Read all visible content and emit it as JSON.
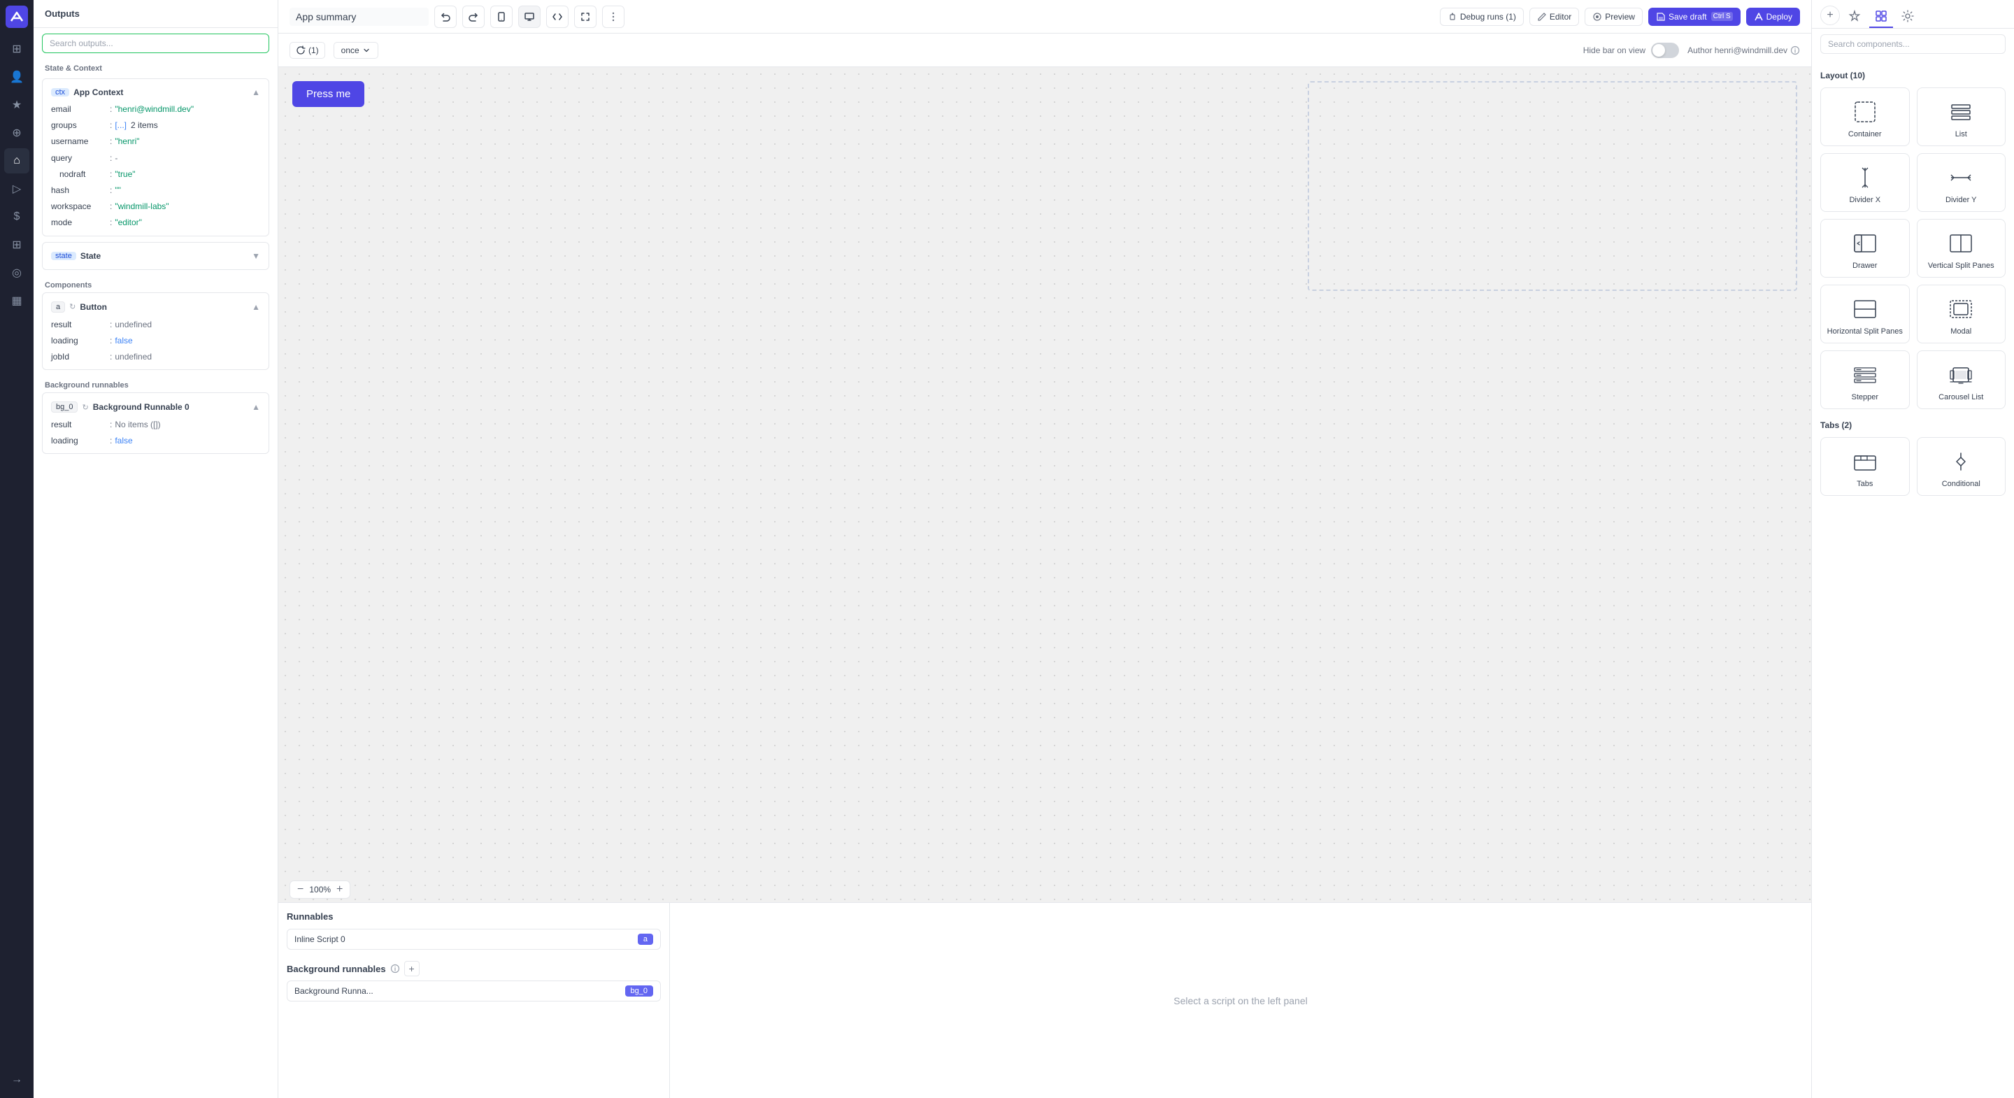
{
  "topbar": {
    "app_title": "App summary",
    "debug_label": "Debug runs (1)",
    "editor_label": "Editor",
    "preview_label": "Preview",
    "save_draft_label": "Save draft",
    "save_draft_kbd": "Ctrl S",
    "deploy_label": "Deploy"
  },
  "canvas_toolbar": {
    "refresh_count": "(1)",
    "once_label": "once",
    "hide_bar_label": "Hide bar on view",
    "author_label": "Author henri@windmill.dev"
  },
  "canvas": {
    "press_me_label": "Press me",
    "zoom_level": "100%",
    "zoom_minus": "−",
    "zoom_plus": "+"
  },
  "sidebar": {
    "outputs_title": "Outputs",
    "search_placeholder": "Search outputs...",
    "state_context_title": "State & Context",
    "ctx_label": "ctx",
    "app_context_label": "App Context",
    "ctx_rows": [
      {
        "key": "email",
        "value": "\"henri@windmill.dev\"",
        "type": "green"
      },
      {
        "key": "groups",
        "value": "[...]",
        "tag": true,
        "suffix": "2 items",
        "type": "blue"
      },
      {
        "key": "username",
        "value": "\"henri\"",
        "type": "green"
      },
      {
        "key": "query",
        "value": "-",
        "type": "gray"
      },
      {
        "key": "nodraft",
        "value": "\"true\"",
        "type": "green",
        "indent": true
      },
      {
        "key": "hash",
        "value": "\"\"",
        "type": "green"
      },
      {
        "key": "workspace",
        "value": "\"windmill-labs\"",
        "type": "green"
      },
      {
        "key": "mode",
        "value": "\"editor\"",
        "type": "green"
      }
    ],
    "state_label": "state",
    "state_title": "State",
    "components_title": "Components",
    "a_label": "a",
    "button_label": "Button",
    "button_rows": [
      {
        "key": "result",
        "value": "undefined",
        "type": "gray"
      },
      {
        "key": "loading",
        "value": "false",
        "type": "blue"
      },
      {
        "key": "jobId",
        "value": "undefined",
        "type": "gray"
      }
    ],
    "bg_runnables_title": "Background runnables",
    "bg_0_label": "bg_0",
    "bg_runnable_0_label": "Background Runnable 0",
    "bg_rows": [
      {
        "key": "result",
        "value": "No items ([])",
        "type": "gray"
      },
      {
        "key": "loading",
        "value": "false",
        "type": "blue"
      }
    ]
  },
  "runnables_panel": {
    "title": "Runnables",
    "inline_script_label": "Inline Script 0",
    "inline_script_tag": "a",
    "bg_runnables_title": "Background runnables",
    "bg_runnable_label": "Background Runna...",
    "bg_runnable_tag": "bg_0",
    "select_script_msg": "Select a script on the left panel"
  },
  "right_panel": {
    "search_placeholder": "Search components...",
    "layout_title": "Layout (10)",
    "layout_items": [
      {
        "label": "Container",
        "icon": "container"
      },
      {
        "label": "List",
        "icon": "list"
      },
      {
        "label": "Divider X",
        "icon": "divider-x"
      },
      {
        "label": "Divider Y",
        "icon": "divider-y"
      },
      {
        "label": "Drawer",
        "icon": "drawer"
      },
      {
        "label": "Vertical Split\nPanes",
        "icon": "vertical-split"
      },
      {
        "label": "Horizontal Split Panes",
        "icon": "horizontal-split"
      },
      {
        "label": "Modal",
        "icon": "modal"
      },
      {
        "label": "Stepper",
        "icon": "stepper"
      },
      {
        "label": "Carousel List",
        "icon": "carousel"
      }
    ],
    "tabs_title": "Tabs (2)",
    "tabs_items": [
      {
        "label": "Tabs",
        "icon": "tabs"
      },
      {
        "label": "Conditional",
        "icon": "conditional"
      }
    ]
  },
  "nav_icons": [
    "home",
    "users",
    "star",
    "person",
    "home2",
    "play",
    "dollar",
    "grid",
    "eye",
    "grid2",
    "arrow"
  ]
}
